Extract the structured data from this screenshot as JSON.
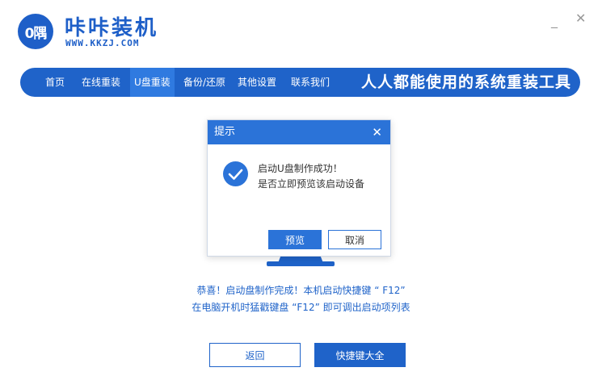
{
  "app": {
    "logo_text": "0隅",
    "name": "咔咔装机",
    "url": "WWW.KKZJ.COM",
    "minimize_glyph": "_",
    "close_glyph": "✕"
  },
  "nav": {
    "items": [
      {
        "label": "首页"
      },
      {
        "label": "在线重装"
      },
      {
        "label": "U盘重装",
        "active": true
      },
      {
        "label": "备份/还原"
      },
      {
        "label": "其他设置"
      },
      {
        "label": "联系我们"
      }
    ],
    "slogan": "人人都能使用的系统重装工具"
  },
  "dialog": {
    "title": "提示",
    "close_glyph": "✕",
    "message_line1": "启动U盘制作成功！",
    "message_line2": "是否立即预览该启动设备",
    "preview_label": "预览",
    "cancel_label": "取消"
  },
  "hint": {
    "line1": "恭喜！启动盘制作完成！本机启动快捷键 “ F12”",
    "line2": "在电脑开机时猛戳键盘 “F12” 即可调出启动项列表"
  },
  "buttons": {
    "back_label": "返回",
    "hotkeys_label": "快捷键大全"
  },
  "colors": {
    "brand_blue": "#1f63c9",
    "dialog_blue": "#2b73d8",
    "active_nav": "#2f7ae0"
  },
  "icons": {
    "success": "check-circle-icon",
    "close": "close-icon",
    "minimize": "minimize-icon"
  }
}
